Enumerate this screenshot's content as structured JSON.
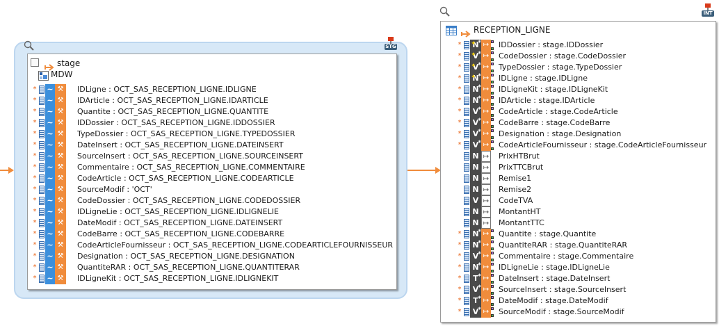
{
  "stage": {
    "title": "stage",
    "subtitle": "MDW",
    "badge": "STG",
    "rows": [
      {
        "label": "IDLigne : OCT_SAS_RECEPTION_LIGNE.IDLIGNE"
      },
      {
        "label": "IDArticle : OCT_SAS_RECEPTION_LIGNE.IDARTICLE"
      },
      {
        "label": "Quantite : OCT_SAS_RECEPTION_LIGNE.QUANTITE"
      },
      {
        "label": "IDDossier : OCT_SAS_RECEPTION_LIGNE.IDDOSSIER"
      },
      {
        "label": "TypeDossier : OCT_SAS_RECEPTION_LIGNE.TYPEDOSSIER"
      },
      {
        "label": "DateInsert : OCT_SAS_RECEPTION_LIGNE.DATEINSERT"
      },
      {
        "label": "SourceInsert : OCT_SAS_RECEPTION_LIGNE.SOURCEINSERT"
      },
      {
        "label": "Commentaire : OCT_SAS_RECEPTION_LIGNE.COMMENTAIRE"
      },
      {
        "label": "CodeArticle : OCT_SAS_RECEPTION_LIGNE.CODEARTICLE"
      },
      {
        "label": "SourceModif : 'OCT'"
      },
      {
        "label": "CodeDossier : OCT_SAS_RECEPTION_LIGNE.CODEDOSSIER"
      },
      {
        "label": "IDLigneLie : OCT_SAS_RECEPTION_LIGNE.IDLIGNELIE"
      },
      {
        "label": "DateModif : OCT_SAS_RECEPTION_LIGNE.DATEINSERT"
      },
      {
        "label": "CodeBarre : OCT_SAS_RECEPTION_LIGNE.CODEBARRE"
      },
      {
        "label": "CodeArticleFournisseur : OCT_SAS_RECEPTION_LIGNE.CODEARTICLEFOURNISSEUR"
      },
      {
        "label": "Designation : OCT_SAS_RECEPTION_LIGNE.DESIGNATION"
      },
      {
        "label": "QuantiteRAR : OCT_SAS_RECEPTION_LIGNE.QUANTITERAR"
      },
      {
        "label": "IDLigneKit : OCT_SAS_RECEPTION_LIGNE.IDLIGNEKIT"
      }
    ]
  },
  "reception": {
    "title": "RECEPTION_LIGNE",
    "badge": "INT",
    "rows": [
      {
        "type": "N",
        "key": true,
        "star": true,
        "mapped": true,
        "label": "IDDossier : stage.IDDossier"
      },
      {
        "type": "V",
        "key": true,
        "star": true,
        "mapped": true,
        "label": "CodeDossier : stage.CodeDossier"
      },
      {
        "type": "V",
        "key": true,
        "star": true,
        "mapped": true,
        "label": "TypeDossier : stage.TypeDossier"
      },
      {
        "type": "N",
        "key": true,
        "star": true,
        "mapped": true,
        "label": "IDLigne : stage.IDLigne"
      },
      {
        "type": "N",
        "key": false,
        "star": true,
        "mapped": true,
        "label": "IDLigneKit : stage.IDLigneKit"
      },
      {
        "type": "N",
        "key": false,
        "star": true,
        "mapped": true,
        "label": "IDArticle : stage.IDArticle"
      },
      {
        "type": "V",
        "key": false,
        "star": true,
        "mapped": true,
        "label": "CodeArticle : stage.CodeArticle"
      },
      {
        "type": "V",
        "key": false,
        "star": true,
        "mapped": true,
        "label": "CodeBarre : stage.CodeBarre"
      },
      {
        "type": "V",
        "key": false,
        "star": true,
        "mapped": true,
        "label": "Designation : stage.Designation"
      },
      {
        "type": "V",
        "key": false,
        "star": true,
        "mapped": true,
        "label": "CodeArticleFournisseur : stage.CodeArticleFournisseur"
      },
      {
        "type": "N",
        "key": false,
        "star": false,
        "mapped": false,
        "label": "PrixHTBrut"
      },
      {
        "type": "N",
        "key": false,
        "star": false,
        "mapped": false,
        "label": "PrixTTCBrut"
      },
      {
        "type": "N",
        "key": false,
        "star": false,
        "mapped": false,
        "label": "Remise1"
      },
      {
        "type": "N",
        "key": false,
        "star": false,
        "mapped": false,
        "label": "Remise2"
      },
      {
        "type": "V",
        "key": false,
        "star": false,
        "mapped": false,
        "label": "CodeTVA"
      },
      {
        "type": "N",
        "key": false,
        "star": false,
        "mapped": false,
        "label": "MontantHT"
      },
      {
        "type": "N",
        "key": false,
        "star": false,
        "mapped": false,
        "label": "MontantTTC"
      },
      {
        "type": "N",
        "key": false,
        "star": true,
        "mapped": true,
        "label": "Quantite : stage.Quantite"
      },
      {
        "type": "N",
        "key": false,
        "star": true,
        "mapped": true,
        "label": "QuantiteRAR : stage.QuantiteRAR"
      },
      {
        "type": "V",
        "key": false,
        "star": true,
        "mapped": true,
        "label": "Commentaire : stage.Commentaire"
      },
      {
        "type": "N",
        "key": false,
        "star": true,
        "mapped": true,
        "label": "IDLigneLie : stage.IDLigneLie"
      },
      {
        "type": "T",
        "key": false,
        "star": true,
        "mapped": true,
        "label": "DateInsert : stage.DateInsert"
      },
      {
        "type": "V",
        "key": false,
        "star": true,
        "mapped": true,
        "label": "SourceInsert : stage.SourceInsert"
      },
      {
        "type": "T",
        "key": false,
        "star": true,
        "mapped": true,
        "label": "DateModif : stage.DateModif"
      },
      {
        "type": "V",
        "key": false,
        "star": true,
        "mapped": true,
        "label": "SourceModif : stage.SourceModif"
      }
    ]
  },
  "icons": {
    "zoom": "magnifier-icon",
    "column": "column-icon",
    "expression": "tilde-icon",
    "transform": "wrench-icon",
    "mapping": "mapping-arrow-icon",
    "table": "table-icon",
    "flow": "orange-arrow-icon"
  },
  "colors": {
    "accent": "#f08c3c",
    "expression": "#3b8fdc",
    "type": "#4a4a4a",
    "group": "#d7e8f7"
  }
}
